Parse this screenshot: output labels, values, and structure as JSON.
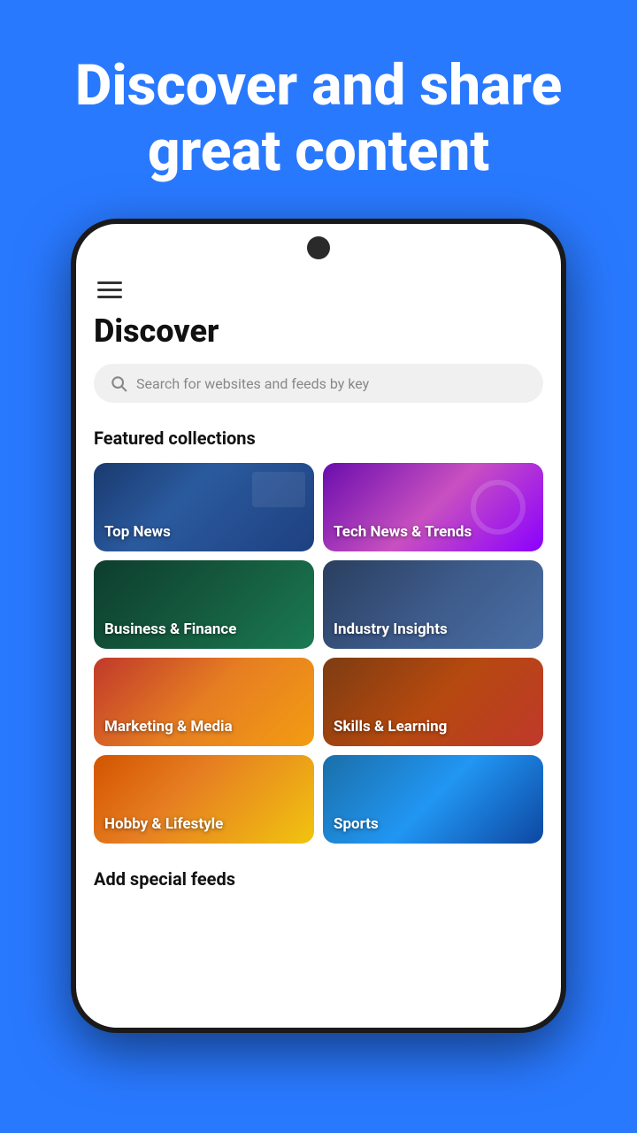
{
  "hero": {
    "title": "Discover and share great content"
  },
  "screen": {
    "page_title": "Discover",
    "search": {
      "placeholder": "Search for websites and feeds by key"
    },
    "featured_section": {
      "label": "Featured collections"
    },
    "collections": [
      {
        "id": "top-news",
        "label": "Top News",
        "style_class": "card-top-news"
      },
      {
        "id": "tech-news",
        "label": "Tech News & Trends",
        "style_class": "card-tech-news"
      },
      {
        "id": "business",
        "label": "Business & Finance",
        "style_class": "card-business"
      },
      {
        "id": "industry",
        "label": "Industry Insights",
        "style_class": "card-industry"
      },
      {
        "id": "marketing",
        "label": "Marketing & Media",
        "style_class": "card-marketing"
      },
      {
        "id": "skills",
        "label": "Skills & Learning",
        "style_class": "card-skills"
      },
      {
        "id": "hobby",
        "label": "Hobby & Lifestyle",
        "style_class": "card-hobby"
      },
      {
        "id": "sports",
        "label": "Sports",
        "style_class": "card-sports"
      }
    ],
    "add_feeds_section": {
      "label": "Add special feeds"
    }
  }
}
